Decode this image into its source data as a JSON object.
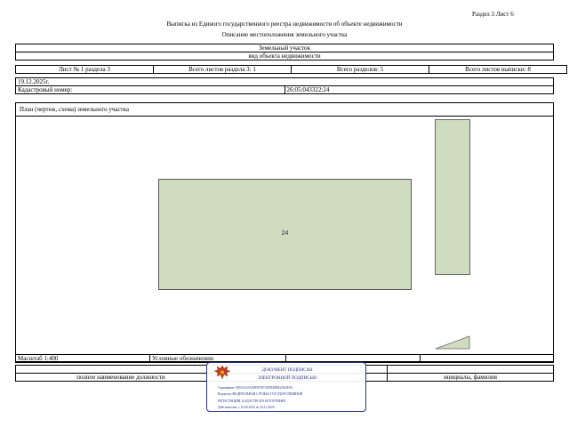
{
  "header": {
    "section_sheet": "Раздел 3   Лист 6",
    "title": "Выписка из Единого государственного реестра недвижимости об объекте недвижимости",
    "subtitle": "Описание местоположения земельного участка"
  },
  "object": {
    "type": "Земельный участок",
    "type_caption": "вид объекта недвижимости"
  },
  "sheet_info": {
    "sheet_no": "Лист № 1 раздела 3",
    "total_sheets_section": "Всего листов раздела 3: 1",
    "total_sections": "Всего разделов: 5",
    "total_sheets_extract": "Всего листов выписки: 8"
  },
  "date": "19.12.2025г.",
  "cadastral": {
    "label": "Кадастровый номер:",
    "value": "26:05:043322:24"
  },
  "plan": {
    "title": "План (чертеж, схема) земельного участка",
    "parcel_label": "24"
  },
  "footer": {
    "scale": "Масштаб 1:400",
    "legend": "Условные обозначения:",
    "position_caption": "полное наименование должности",
    "name_caption": "инициалы, фамилия"
  },
  "stamp": {
    "line1": "ДОКУМЕНТ ПОДПИСАН",
    "line2": "ЭЛЕКТРОННОЙ ПОДПИСЬЮ",
    "certificate": "Сертификат: 00913A43A5995078C5E0D38DE4A02E9A",
    "owner_1": "Владелец: ФЕДЕРАЛЬНАЯ СЛУЖБА ГОСУДАРСТВЕННОЙ",
    "owner_2": "РЕГИСТРАЦИИ, КАДАСТРА И КАРТОГРАФИИ",
    "validity": "Действителен: с 16.09.2025 по 10.12.2026",
    "color": "#27328a"
  },
  "colors": {
    "parcel_fill": "#cfdcc0"
  }
}
